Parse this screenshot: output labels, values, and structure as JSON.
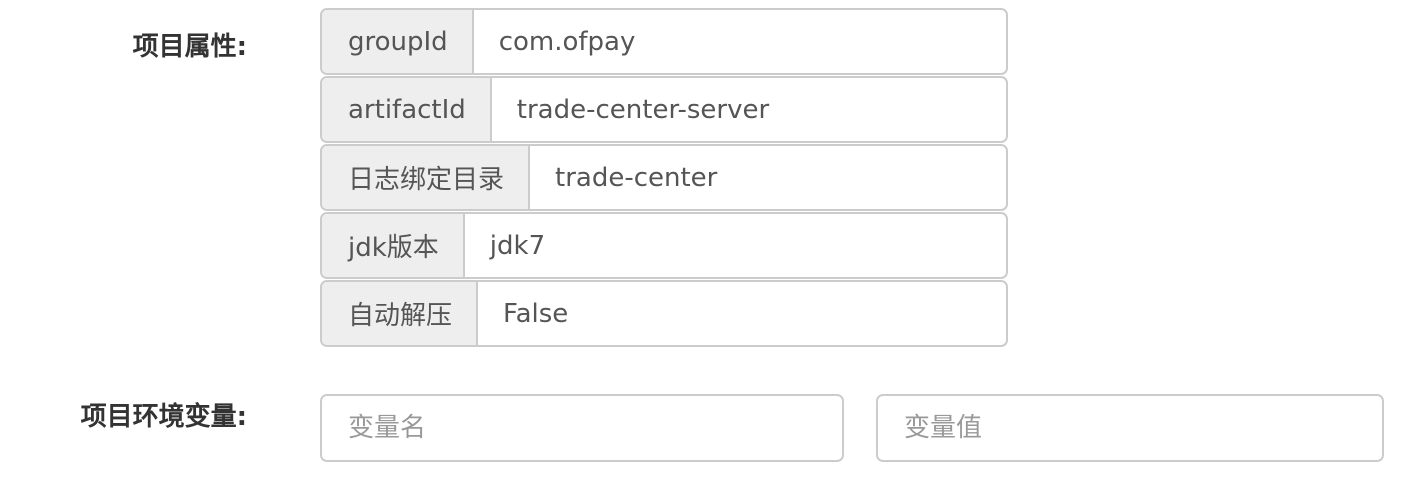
{
  "project_properties": {
    "label": "项目属性:",
    "rows": [
      {
        "key": "groupId",
        "value": "com.ofpay"
      },
      {
        "key": "artifactId",
        "value": "trade-center-server"
      },
      {
        "key": "日志绑定目录",
        "value": "trade-center"
      },
      {
        "key": "jdk版本",
        "value": "jdk7"
      },
      {
        "key": "自动解压",
        "value": "False"
      }
    ]
  },
  "env_vars": {
    "label": "项目环境变量:",
    "name_placeholder": "变量名",
    "value_placeholder": "变量值"
  }
}
